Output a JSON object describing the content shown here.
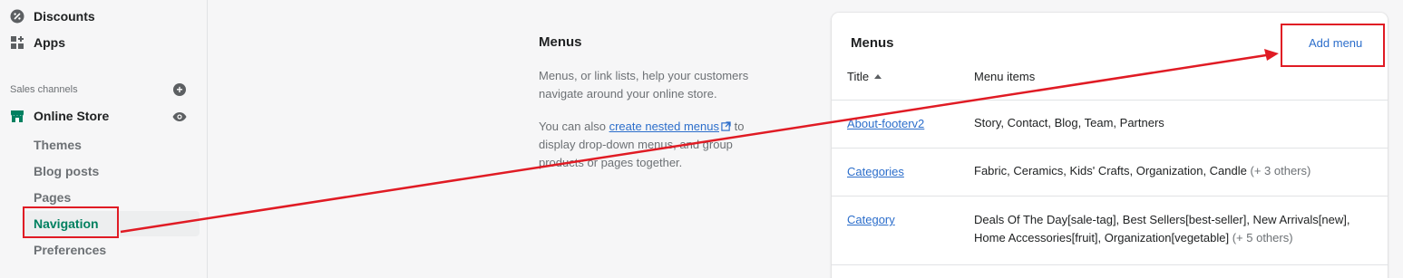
{
  "sidebar": {
    "top_items": [
      {
        "label": "Discounts",
        "icon": "discounts-icon"
      },
      {
        "label": "Apps",
        "icon": "apps-icon"
      }
    ],
    "section_title": "Sales channels",
    "channel": {
      "label": "Online Store",
      "icon": "store-icon"
    },
    "sub_items": [
      {
        "label": "Themes"
      },
      {
        "label": "Blog posts"
      },
      {
        "label": "Pages"
      },
      {
        "label": "Navigation",
        "active": true
      },
      {
        "label": "Preferences"
      }
    ]
  },
  "description": {
    "heading": "Menus",
    "para1": "Menus, or link lists, help your customers navigate around your online store.",
    "para2_prefix": "You can also ",
    "para2_link": "create nested menus",
    "para2_suffix": " to display drop-down menus, and group products or pages together."
  },
  "card": {
    "title": "Menus",
    "add_button": "Add menu",
    "columns": {
      "title": "Title",
      "items": "Menu items"
    },
    "rows": [
      {
        "title": "About-footerv2",
        "items": "Story, Contact, Blog, Team, Partners",
        "more": ""
      },
      {
        "title": "Categories",
        "items": "Fabric, Ceramics, Kids' Crafts, Organization, Candle",
        "more": "(+ 3 others)"
      },
      {
        "title": "Category",
        "items": "Deals Of The Day[sale-tag], Best Sellers[best-seller], New Arrivals[new], Home Accessories[fruit], Organization[vegetable]",
        "more": "(+ 5 others)"
      }
    ]
  },
  "colors": {
    "accent_green": "#008060",
    "link_blue": "#2c6ecb",
    "annotation_red": "#e01b24"
  }
}
